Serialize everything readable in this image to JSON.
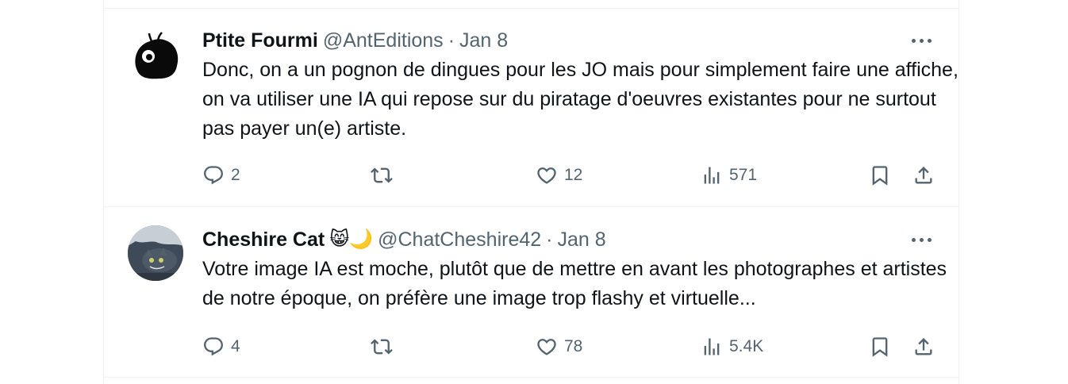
{
  "tweets": [
    {
      "author": {
        "name": "Ptite Fourmi",
        "handle": "@AntEditions",
        "separator": "·",
        "date": "Jan 8",
        "avatar": "black-blob-avatar"
      },
      "text": "Donc, on a un pognon de dingues pour les JO mais pour simplement faire une affiche, on va utiliser une IA qui repose sur du piratage d'oeuvres existantes pour ne surtout pas payer un(e) artiste.",
      "stats": {
        "replies": "2",
        "retweets": "",
        "likes": "12",
        "views": "571"
      }
    },
    {
      "author": {
        "name": "Cheshire Cat",
        "emoji": "😸🌙",
        "handle": "@ChatCheshire42",
        "separator": "·",
        "date": "Jan 8",
        "avatar": "cheshire-cat-photo-avatar"
      },
      "text": "Votre image IA est moche, plutôt que de mettre en avant les photographes et artistes de notre époque, on préfère une image trop flashy et virtuelle...",
      "stats": {
        "replies": "4",
        "retweets": "",
        "likes": "78",
        "views": "5.4K"
      }
    }
  ],
  "icons": {
    "reply": "reply-icon",
    "retweet": "retweet-icon",
    "like": "heart-icon",
    "views": "views-icon",
    "bookmark": "bookmark-icon",
    "share": "share-icon",
    "more": "more-icon"
  },
  "colors": {
    "text": "#0f1419",
    "secondary": "#536471",
    "divider": "#eff3f4"
  }
}
